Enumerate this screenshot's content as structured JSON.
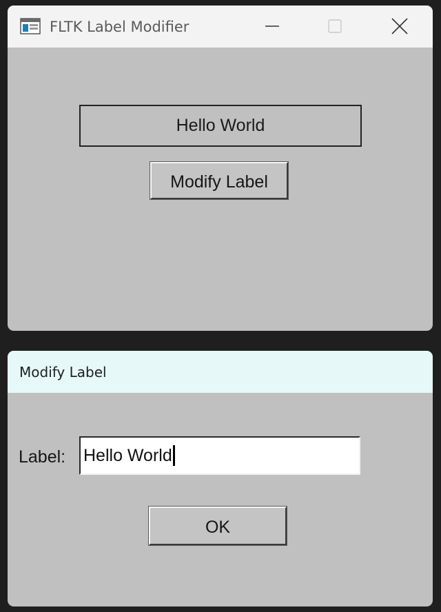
{
  "main_window": {
    "title": "FLTK Label Modifier",
    "icon": "application-window-icon",
    "caption_buttons": [
      "minimize-icon",
      "maximize-icon",
      "close-icon"
    ],
    "label_text": "Hello World",
    "modify_button_label": "Modify Label"
  },
  "dialog": {
    "title": "Modify Label",
    "field_label": "Label:",
    "field_value": "Hello World",
    "ok_button_label": "OK"
  },
  "colors": {
    "window_background": "#c0c0c0",
    "main_titlebar": "#f3f3f3",
    "dialog_titlebar": "#e6f8f8",
    "desktop": "#1f1f1f"
  }
}
